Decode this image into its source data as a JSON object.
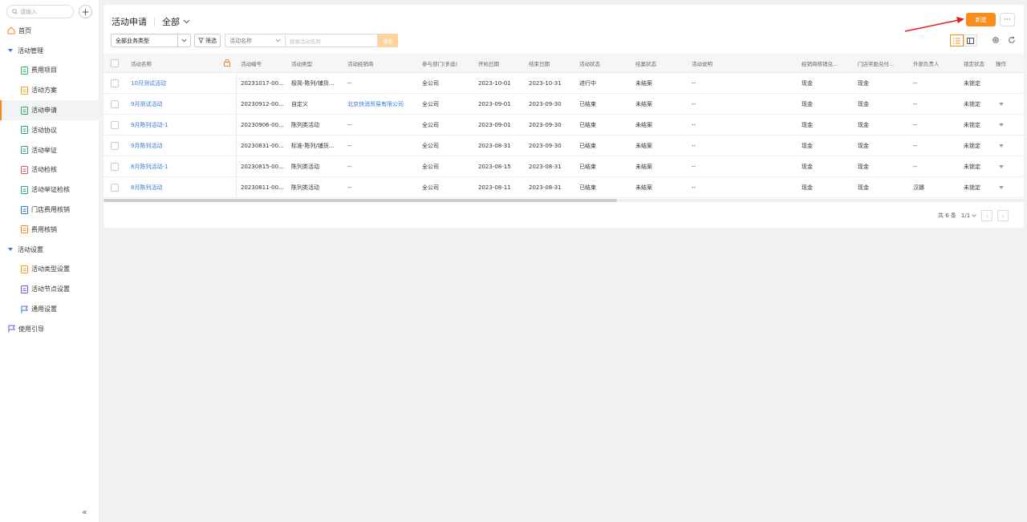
{
  "sidebar": {
    "search_placeholder": "请输入",
    "add_label": "+",
    "items": [
      {
        "label": "首页",
        "kind": "top",
        "icon": "home-icon"
      },
      {
        "label": "活动管理",
        "kind": "group"
      },
      {
        "label": "费用项目",
        "kind": "sub",
        "icon": "cost-item-icon"
      },
      {
        "label": "活动方案",
        "kind": "sub",
        "icon": "plan-icon"
      },
      {
        "label": "活动申请",
        "kind": "sub",
        "icon": "apply-icon",
        "active": true
      },
      {
        "label": "活动协议",
        "kind": "sub",
        "icon": "agreement-icon"
      },
      {
        "label": "活动举证",
        "kind": "sub",
        "icon": "evidence-icon"
      },
      {
        "label": "活动检核",
        "kind": "sub",
        "icon": "check-icon"
      },
      {
        "label": "活动举证检核",
        "kind": "sub",
        "icon": "evidence-check-icon"
      },
      {
        "label": "门店费用核销",
        "kind": "sub",
        "icon": "store-cost-icon"
      },
      {
        "label": "费用核销",
        "kind": "sub",
        "icon": "writeoff-icon"
      },
      {
        "label": "活动设置",
        "kind": "group"
      },
      {
        "label": "活动类型设置",
        "kind": "sub",
        "icon": "type-setting-icon"
      },
      {
        "label": "活动节点设置",
        "kind": "sub",
        "icon": "node-setting-icon"
      },
      {
        "label": "通用设置",
        "kind": "sub",
        "icon": "flag-icon"
      },
      {
        "label": "使用引导",
        "kind": "top",
        "icon": "guide-flag-icon"
      }
    ],
    "collapse_label": "«"
  },
  "header": {
    "title": "活动申请",
    "view": "全部",
    "new_button": "新建",
    "more_button": "···"
  },
  "filters": {
    "business_type": "全部业务类型",
    "filter_button": "筛选",
    "field_select": "活动名称",
    "keyword_placeholder": "搜索活动名称",
    "search_button": "搜索"
  },
  "table": {
    "columns": [
      "活动名称",
      "活动编号",
      "活动类型",
      "活动经销商",
      "参与部门(多选)",
      "开始日期",
      "结束日期",
      "活动状态",
      "结案状态",
      "活动说明",
      "经销商核销兑...",
      "门店奖励兑付...",
      "外部负责人",
      "锁定状态",
      "操作"
    ],
    "rows": [
      [
        "10月测试活动",
        "20231017-00...",
        "极简-陈列/铺货...",
        "--",
        "全公司",
        "2023-10-01",
        "2023-10-31",
        "进行中",
        "未结案",
        "--",
        "现金",
        "现金",
        "--",
        "未锁定",
        ""
      ],
      [
        "9月测试活动",
        "20230912-00...",
        "自定义",
        "北京快消贸易有限公司",
        "全公司",
        "2023-09-01",
        "2023-09-30",
        "已结束",
        "未结案",
        "--",
        "现金",
        "现金",
        "--",
        "未锁定",
        "▾"
      ],
      [
        "9月陈列活动-1",
        "20230906-00...",
        "陈列类活动",
        "--",
        "全公司",
        "2023-09-01",
        "2023-09-30",
        "已结束",
        "未结案",
        "--",
        "现金",
        "现金",
        "--",
        "未锁定",
        "▾"
      ],
      [
        "9月陈列活动",
        "20230831-00...",
        "标准-陈列/铺货...",
        "--",
        "全公司",
        "2023-08-31",
        "2023-09-30",
        "已结束",
        "未结案",
        "--",
        "现金",
        "现金",
        "--",
        "未锁定",
        "▾"
      ],
      [
        "8月陈列活动-1",
        "20230815-00...",
        "陈列类活动",
        "--",
        "全公司",
        "2023-08-15",
        "2023-08-31",
        "已结束",
        "未结案",
        "--",
        "现金",
        "现金",
        "--",
        "未锁定",
        "▾"
      ],
      [
        "8月陈列活动",
        "20230811-00...",
        "陈列类活动",
        "--",
        "全公司",
        "2023-08-11",
        "2023-08-31",
        "已结束",
        "未结案",
        "--",
        "现金",
        "现金",
        "汉娜",
        "未锁定",
        "▾"
      ]
    ]
  },
  "pagination": {
    "total": "共 6 条",
    "page": "1/1",
    "prev": "‹",
    "next": "›"
  },
  "colors": {
    "accent": "#f98d1b",
    "link": "#3a78d8",
    "annotation_arrow": "#e02020"
  }
}
